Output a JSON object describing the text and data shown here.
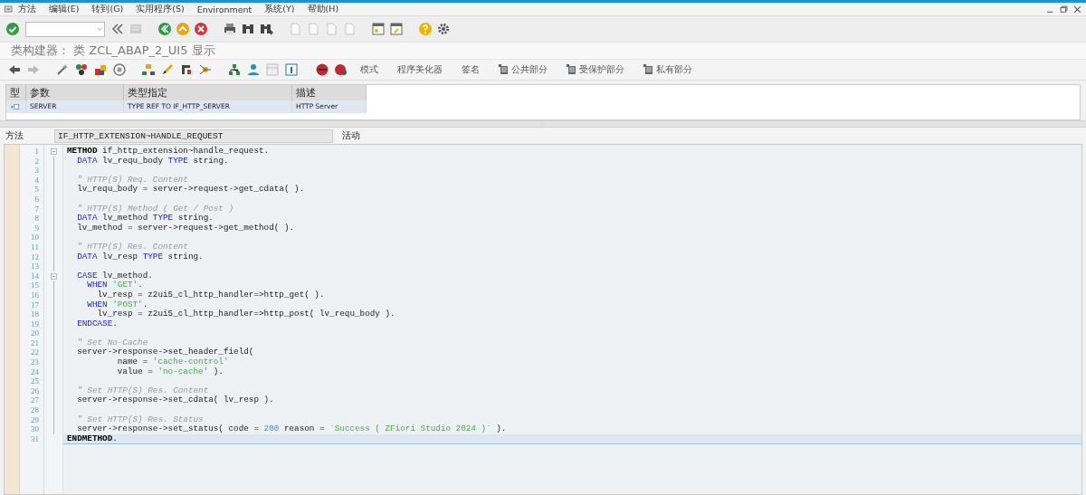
{
  "menu": [
    "方法",
    "编辑(E)",
    "转到(G)",
    "实用程序(S)",
    "Environment",
    "系统(Y)",
    "帮助(H)"
  ],
  "title": "类构建器： 类 ZCL_ABAP_2_UI5 显示",
  "app_toolbar": [
    {
      "label": "模式",
      "icon": false
    },
    {
      "label": "程序美化器",
      "icon": false
    },
    {
      "label": "签名",
      "icon": false
    },
    {
      "label": "公共部分",
      "icon": true
    },
    {
      "label": "受保护部分",
      "icon": true
    },
    {
      "label": "私有部分",
      "icon": true
    }
  ],
  "parameters": {
    "columns": [
      "型",
      "参数",
      "类型指定",
      "描述"
    ],
    "rows": [
      {
        "name": "SERVER",
        "type": "TYPE REF TO IF_HTTP_SERVER",
        "description": "HTTP Server",
        "selected": true
      }
    ]
  },
  "method": {
    "label": "方法",
    "value": "IF_HTTP_EXTENSION~HANDLE_REQUEST",
    "status": "活动"
  },
  "editor": {
    "lines": [
      {
        "number": "1",
        "fold": true,
        "current": false,
        "tokens": [
          {
            "kind": "bold",
            "text": "METHOD"
          },
          {
            "kind": "text",
            "text": " if_http_extension~handle_request."
          }
        ]
      },
      {
        "number": "2",
        "fold": false,
        "current": false,
        "tokens": [
          {
            "kind": "keyword",
            "text": "  DATA"
          },
          {
            "kind": "text",
            "text": " lv_requ_body "
          },
          {
            "kind": "keyword",
            "text": "TYPE"
          },
          {
            "kind": "text",
            "text": " string."
          }
        ]
      },
      {
        "number": "3",
        "fold": false,
        "current": false
      },
      {
        "number": "4",
        "fold": false,
        "current": false,
        "tokens": [
          {
            "kind": "comment",
            "text": "  \" HTTP(S) Req. Content"
          }
        ]
      },
      {
        "number": "5",
        "fold": false,
        "current": false,
        "tokens": [
          {
            "kind": "text",
            "text": "  lv_requ_body = server->request->get_cdata( )."
          }
        ]
      },
      {
        "number": "6",
        "fold": false,
        "current": false
      },
      {
        "number": "7",
        "fold": false,
        "current": false,
        "tokens": [
          {
            "kind": "comment",
            "text": "  \" HTTP(S) Method ( Get / Post )"
          }
        ]
      },
      {
        "number": "8",
        "fold": false,
        "current": false,
        "tokens": [
          {
            "kind": "keyword",
            "text": "  DATA"
          },
          {
            "kind": "text",
            "text": " lv_method "
          },
          {
            "kind": "keyword",
            "text": "TYPE"
          },
          {
            "kind": "text",
            "text": " string."
          }
        ]
      },
      {
        "number": "9",
        "fold": false,
        "current": false,
        "tokens": [
          {
            "kind": "text",
            "text": "  lv_method = server->request->get_method( )."
          }
        ]
      },
      {
        "number": "10",
        "fold": false,
        "current": false
      },
      {
        "number": "11",
        "fold": false,
        "current": false,
        "tokens": [
          {
            "kind": "comment",
            "text": "  \" HTTP(S) Res. Content"
          }
        ]
      },
      {
        "number": "12",
        "fold": false,
        "current": false,
        "tokens": [
          {
            "kind": "keyword",
            "text": "  DATA"
          },
          {
            "kind": "text",
            "text": " lv_resp "
          },
          {
            "kind": "keyword",
            "text": "TYPE"
          },
          {
            "kind": "text",
            "text": " string."
          }
        ]
      },
      {
        "number": "13",
        "fold": false,
        "current": false
      },
      {
        "number": "14",
        "fold": true,
        "current": false,
        "tokens": [
          {
            "kind": "keyword",
            "text": "  CASE"
          },
          {
            "kind": "text",
            "text": " lv_method."
          }
        ]
      },
      {
        "number": "15",
        "fold": false,
        "current": false,
        "tokens": [
          {
            "kind": "keyword",
            "text": "    WHEN "
          },
          {
            "kind": "string",
            "text": "'GET'"
          },
          {
            "kind": "text",
            "text": "."
          }
        ]
      },
      {
        "number": "16",
        "fold": false,
        "current": false,
        "tokens": [
          {
            "kind": "text",
            "text": "      lv_resp = z2ui5_cl_http_handler=>http_get( )."
          }
        ]
      },
      {
        "number": "17",
        "fold": false,
        "current": false,
        "tokens": [
          {
            "kind": "keyword",
            "text": "    WHEN "
          },
          {
            "kind": "string",
            "text": "'POST'"
          },
          {
            "kind": "text",
            "text": "."
          }
        ]
      },
      {
        "number": "18",
        "fold": false,
        "current": false,
        "tokens": [
          {
            "kind": "text",
            "text": "      lv_resp = z2ui5_cl_http_handler=>http_post( lv_requ_body )."
          }
        ]
      },
      {
        "number": "19",
        "fold": false,
        "current": false,
        "tokens": [
          {
            "kind": "keyword",
            "text": "  ENDCASE"
          },
          {
            "kind": "text",
            "text": "."
          }
        ]
      },
      {
        "number": "20",
        "fold": false,
        "current": false
      },
      {
        "number": "21",
        "fold": false,
        "current": false,
        "tokens": [
          {
            "kind": "comment",
            "text": "  \" Set No-Cache"
          }
        ]
      },
      {
        "number": "22",
        "fold": false,
        "current": false,
        "tokens": [
          {
            "kind": "text",
            "text": "  server->response->set_header_field("
          }
        ]
      },
      {
        "number": "23",
        "fold": false,
        "current": false,
        "tokens": [
          {
            "kind": "text",
            "text": "          name = "
          },
          {
            "kind": "string",
            "text": "'cache-control'"
          }
        ]
      },
      {
        "number": "24",
        "fold": false,
        "current": false,
        "tokens": [
          {
            "kind": "text",
            "text": "          value = "
          },
          {
            "kind": "string",
            "text": "'no-cache'"
          },
          {
            "kind": "text",
            "text": " )."
          }
        ]
      },
      {
        "number": "25",
        "fold": false,
        "current": false
      },
      {
        "number": "26",
        "fold": false,
        "current": false,
        "tokens": [
          {
            "kind": "comment",
            "text": "  \" Set HTTP(S) Res. Content"
          }
        ]
      },
      {
        "number": "27",
        "fold": false,
        "current": false,
        "tokens": [
          {
            "kind": "text",
            "text": "  server->response->set_cdata( lv_resp )."
          }
        ]
      },
      {
        "number": "28",
        "fold": false,
        "current": false
      },
      {
        "number": "29",
        "fold": false,
        "current": false,
        "tokens": [
          {
            "kind": "comment",
            "text": "  \" Set HTTP(S) Res. Status"
          }
        ]
      },
      {
        "number": "30",
        "fold": false,
        "current": false,
        "tokens": [
          {
            "kind": "text",
            "text": "  server->response->set_status( code = "
          },
          {
            "kind": "number",
            "text": "200"
          },
          {
            "kind": "text",
            "text": " reason = "
          },
          {
            "kind": "string",
            "text": "`Success ( ZFiori Studio 2024 )`"
          },
          {
            "kind": "text",
            "text": " )."
          }
        ]
      },
      {
        "number": "31",
        "fold": false,
        "current": true,
        "tokens": [
          {
            "kind": "bold",
            "text": "ENDMETHOD"
          },
          {
            "kind": "text",
            "text": "."
          }
        ]
      }
    ]
  }
}
